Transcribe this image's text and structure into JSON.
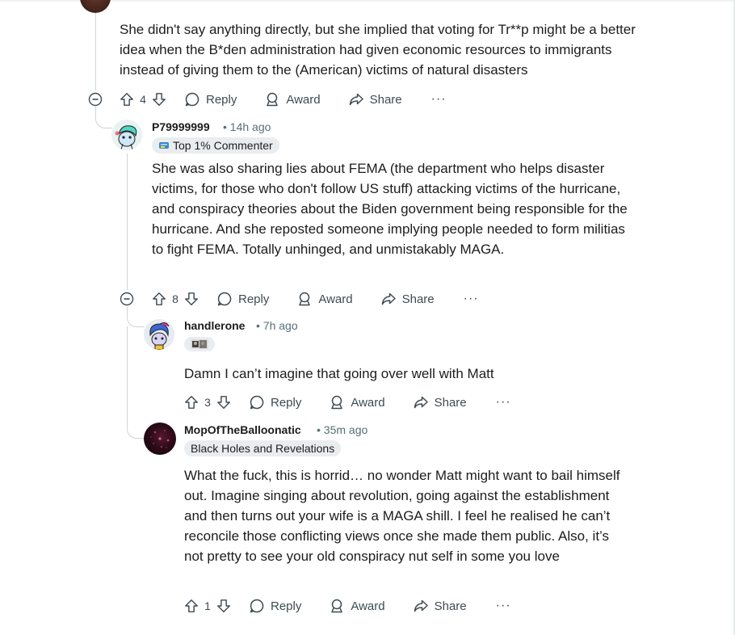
{
  "comments": [
    {
      "body": "She didn't say anything directly, but she implied that voting for Tr**p might be a better idea when the B*den administration had given economic resources to immigrants instead of giving them to the (American) victims of natural disasters",
      "votes": "4"
    },
    {
      "username": "P79999999",
      "time": "14h ago",
      "flair": "Top 1% Commenter",
      "body": "She was also sharing lies about FEMA (the department who helps disaster victims, for those who don't follow US stuff) attacking victims of the hurricane, and conspiracy theories about the Biden government being responsible for the hurricane. And she reposted someone implying people needed to form militias to fight FEMA. Totally unhinged, and unmistakably MAGA.",
      "votes": "8"
    },
    {
      "username": "handlerone",
      "time": "7h ago",
      "body": "Damn I can’t imagine that going over well with Matt",
      "votes": "3"
    },
    {
      "username": "MopOfTheBalloonatic",
      "time": "35m ago",
      "flair": "Black Holes and Revelations",
      "body": "What the fuck, this is horrid… no wonder Matt might want to bail himself out. Imagine singing about revolution, going against the establishment and then turns out your wife is a MAGA shill. I feel he realised he can’t reconcile those conflicting views once she made them public. Also, it’s not pretty to see your old conspiracy nut self in some you love",
      "votes": "1"
    }
  ],
  "actions": {
    "reply": "Reply",
    "award": "Award",
    "share": "Share",
    "more": "···",
    "separator": "•"
  },
  "icons": {
    "upvote": "arrow-up-outline-icon",
    "downvote": "arrow-down-outline-icon",
    "reply": "speech-bubble-icon",
    "award": "award-ribbon-icon",
    "share": "share-arrow-icon",
    "collapse": "circle-minus-icon"
  },
  "colors": {
    "text": "#1c1c1c",
    "meta": "#576f76",
    "flair_bg": "#eaedef",
    "thread_line": "#d0d4d6"
  }
}
